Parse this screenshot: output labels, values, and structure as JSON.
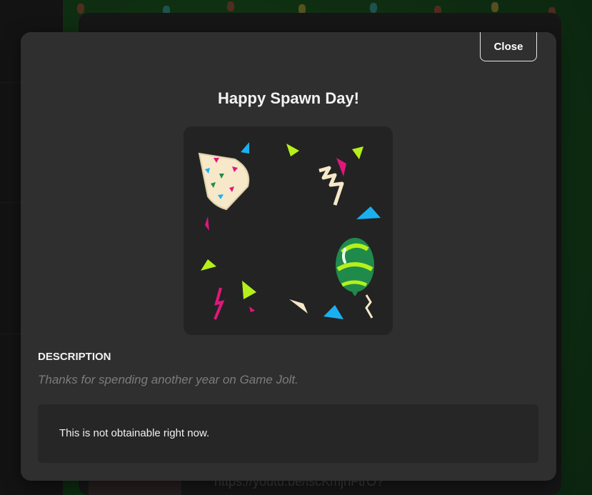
{
  "background": {
    "url_fragment": "https://youtu.be/iscKmjnFtrO?"
  },
  "modal": {
    "close_label": "Close",
    "title": "Happy Spawn Day!",
    "description_heading": "DESCRIPTION",
    "description_text": "Thanks for spending another year on Game Jolt.",
    "notice_text": "This is not obtainable right now."
  },
  "colors": {
    "modal_bg": "#2f2f2f",
    "art_bg": "#232323",
    "confetti_blue": "#1ab0f0",
    "confetti_lime": "#b5f01a",
    "confetti_pink": "#e0177a",
    "balloon_green": "#1f8a4c",
    "party_hat": "#f6e8c8"
  },
  "icons": [
    "party-hat-icon",
    "balloon-icon",
    "confetti-icon",
    "streamer-icon"
  ]
}
